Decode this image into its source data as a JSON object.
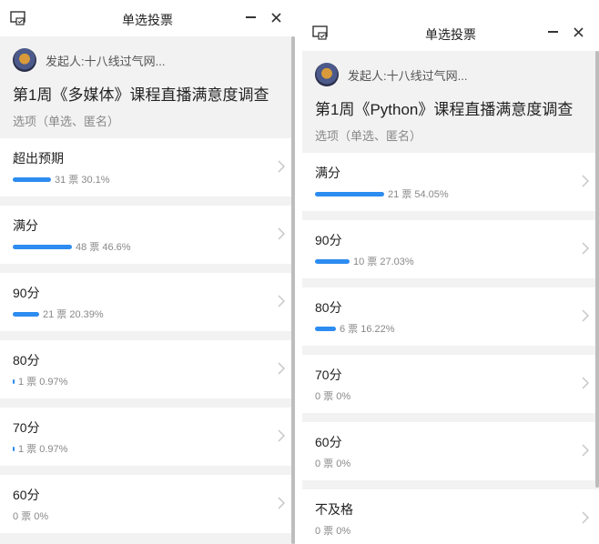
{
  "colors": {
    "accent": "#2d8cf0",
    "page_bg": "#f2f2f2",
    "card_bg": "#ffffff"
  },
  "windows": [
    {
      "title": "单选投票",
      "creator": "发起人:十八线过气网...",
      "vote_title": "第1周《多媒体》课程直播满意度调查",
      "vote_subtitle": "选项（单选、匿名）",
      "options": [
        {
          "label": "超出预期",
          "stats": "31 票 30.1%",
          "percent": 30.1
        },
        {
          "label": "满分",
          "stats": "48 票 46.6%",
          "percent": 46.6
        },
        {
          "label": "90分",
          "stats": "21 票 20.39%",
          "percent": 20.39
        },
        {
          "label": "80分",
          "stats": "1 票 0.97%",
          "percent": 0.97
        },
        {
          "label": "70分",
          "stats": "1 票 0.97%",
          "percent": 0.97
        },
        {
          "label": "60分",
          "stats": "0 票 0%",
          "percent": 0
        }
      ]
    },
    {
      "title": "单选投票",
      "creator": "发起人:十八线过气网...",
      "vote_title": "第1周《Python》课程直播满意度调查",
      "vote_subtitle": "选项（单选、匿名）",
      "options": [
        {
          "label": "满分",
          "stats": "21 票 54.05%",
          "percent": 54.05
        },
        {
          "label": "90分",
          "stats": "10 票 27.03%",
          "percent": 27.03
        },
        {
          "label": "80分",
          "stats": "6 票 16.22%",
          "percent": 16.22
        },
        {
          "label": "70分",
          "stats": "0 票 0%",
          "percent": 0
        },
        {
          "label": "60分",
          "stats": "0 票 0%",
          "percent": 0
        },
        {
          "label": "不及格",
          "stats": "0 票 0%",
          "percent": 0
        }
      ]
    }
  ]
}
